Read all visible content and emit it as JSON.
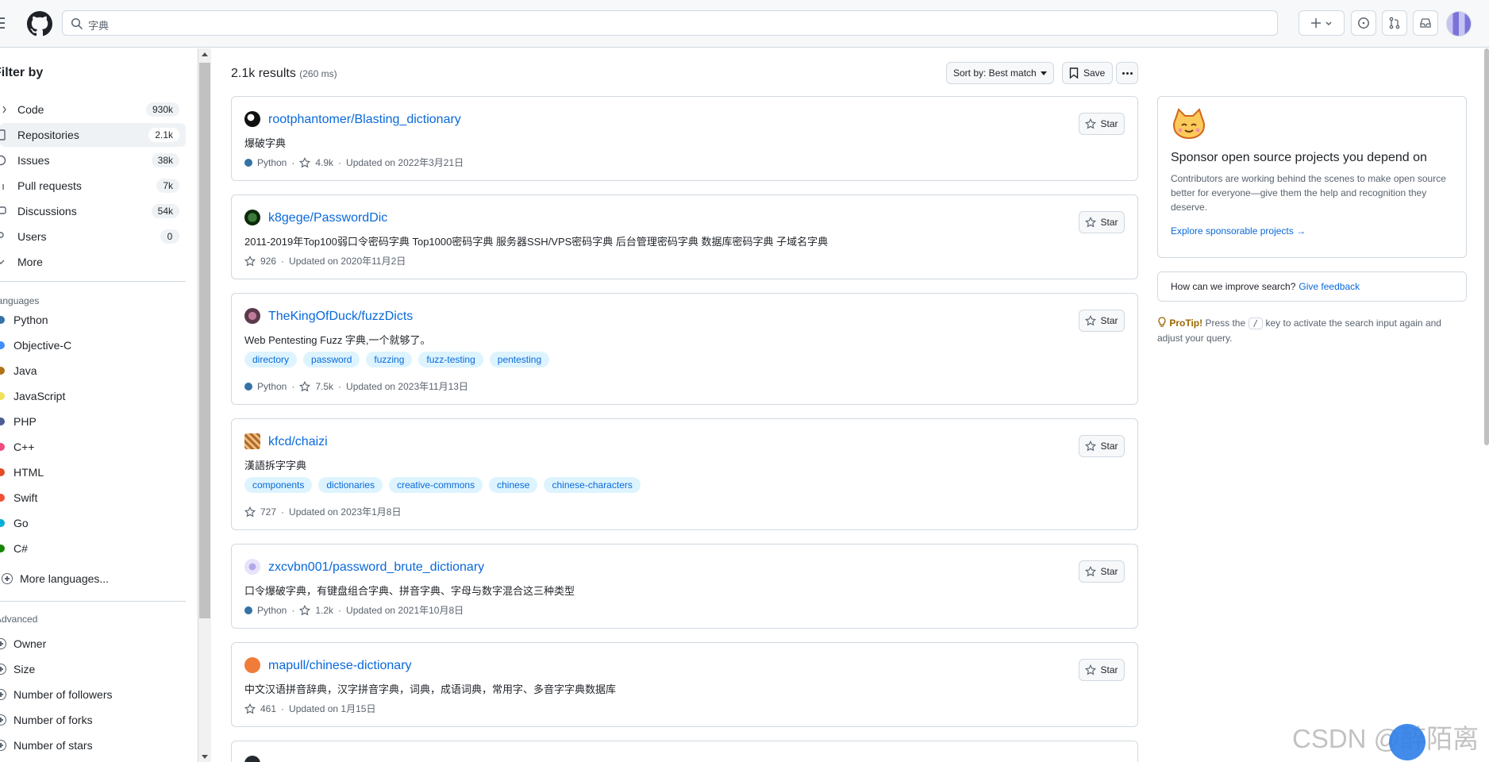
{
  "header": {
    "search_value": "字典"
  },
  "sidebar": {
    "title": "Filter by",
    "types": [
      {
        "label": "Code",
        "count": "930k"
      },
      {
        "label": "Repositories",
        "count": "2.1k"
      },
      {
        "label": "Issues",
        "count": "38k"
      },
      {
        "label": "Pull requests",
        "count": "7k"
      },
      {
        "label": "Discussions",
        "count": "54k"
      },
      {
        "label": "Users",
        "count": "0"
      },
      {
        "label": "More",
        "count": ""
      }
    ],
    "languages_heading": "Languages",
    "languages": [
      {
        "label": "Python",
        "color": "#3572A5"
      },
      {
        "label": "Objective-C",
        "color": "#438eff"
      },
      {
        "label": "Java",
        "color": "#b07219"
      },
      {
        "label": "JavaScript",
        "color": "#f1e05a"
      },
      {
        "label": "PHP",
        "color": "#4F5D95"
      },
      {
        "label": "C++",
        "color": "#f34b7d"
      },
      {
        "label": "HTML",
        "color": "#e34c26"
      },
      {
        "label": "Swift",
        "color": "#F05138"
      },
      {
        "label": "Go",
        "color": "#00ADD8"
      },
      {
        "label": "C#",
        "color": "#178600"
      }
    ],
    "more_languages": "More languages...",
    "advanced_heading": "Advanced",
    "advanced": [
      "Owner",
      "Size",
      "Number of followers",
      "Number of forks",
      "Number of stars"
    ]
  },
  "results": {
    "count": "2.1k results",
    "time": "(260 ms)",
    "sort_label": "Sort by: Best match",
    "save_label": "Save",
    "star_label": "Star",
    "items": [
      {
        "name": "rootphantomer/Blasting_dictionary",
        "desc": "爆破字典",
        "lang": "Python",
        "stars": "4.9k",
        "updated": "Updated on 2022年3月21日",
        "topics": []
      },
      {
        "name": "k8gege/PasswordDic",
        "desc": "2011-2019年Top100弱口令密码字典 Top1000密码字典 服务器SSH/VPS密码字典 后台管理密码字典 数据库密码字典 子域名字典",
        "lang": "",
        "stars": "926",
        "updated": "Updated on 2020年11月2日",
        "topics": []
      },
      {
        "name": "TheKingOfDuck/fuzzDicts",
        "desc": "Web Pentesting Fuzz 字典,一个就够了。",
        "lang": "Python",
        "stars": "7.5k",
        "updated": "Updated on 2023年11月13日",
        "topics": [
          "directory",
          "password",
          "fuzzing",
          "fuzz-testing",
          "pentesting"
        ]
      },
      {
        "name": "kfcd/chaizi",
        "desc": "漢語拆字字典",
        "lang": "",
        "stars": "727",
        "updated": "Updated on 2023年1月8日",
        "topics": [
          "components",
          "dictionaries",
          "creative-commons",
          "chinese",
          "chinese-characters"
        ]
      },
      {
        "name": "zxcvbn001/password_brute_dictionary",
        "desc": "口令爆破字典，有键盘组合字典、拼音字典、字母与数字混合这三种类型",
        "lang": "Python",
        "stars": "1.2k",
        "updated": "Updated on 2021年10月8日",
        "topics": []
      },
      {
        "name": "mapull/chinese-dictionary",
        "desc": "中文汉语拼音辞典，汉字拼音字典，词典，成语词典，常用字、多音字字典数据库",
        "lang": "",
        "stars": "461",
        "updated": "Updated on 1月15日",
        "topics": []
      }
    ]
  },
  "right": {
    "sponsor_title": "Sponsor open source projects you depend on",
    "sponsor_text": "Contributors are working behind the scenes to make open source better for everyone—give them the help and recognition they deserve.",
    "sponsor_link": "Explore sponsorable projects →",
    "feedback_q": "How can we improve search?",
    "feedback_link": "Give feedback",
    "protip_label": "ProTip!",
    "protip_pre": "Press the",
    "protip_key": "/",
    "protip_post": "key to activate the search input again and adjust your query."
  },
  "watermark": "CSDN @醉陌离"
}
